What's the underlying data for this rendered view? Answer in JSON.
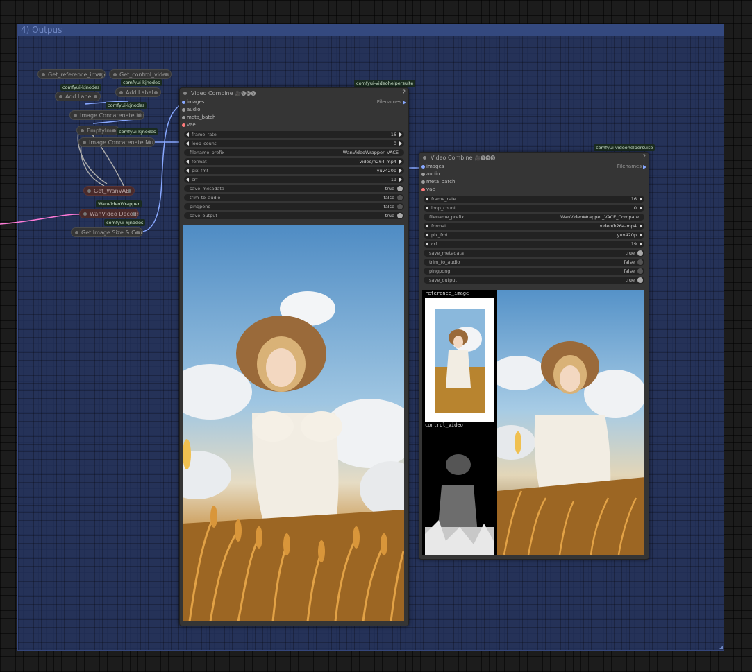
{
  "group": {
    "title": "4) Outpus"
  },
  "mini_nodes": {
    "get_reference_image": "Get_reference_image",
    "get_control_video": "Get_control_video",
    "add_label_1": "Add Label",
    "add_label_2": "Add Label",
    "image_concat_1": "Image Concatenate Mu",
    "empty_image": "EmptyIma",
    "image_concat_2": "Image Concatenate Mu",
    "get_wanvae": "Get_WanVAE",
    "wanvideo_decode": "WanVideo Decode",
    "get_image_size": "Get Image Size & Cou"
  },
  "tags": {
    "kjnodes_1": "comfyui-kjnodes",
    "kjnodes_2": "comfyui-kjnodes",
    "kjnodes_3": "comfyui-kjnodes",
    "kjnodes_4": "comfyui-kjnodes",
    "kjnodes_5": "comfyui-kjnodes",
    "wanvideowrapper": "WanVideoWrapper",
    "vhs_1": "comfyui-videohelpersuite",
    "vhs_2": "comfyui-videohelpersuite"
  },
  "video_combine_1": {
    "title": "Video Combine",
    "title_icons": "🎥🅥🅗🅢",
    "help": "?",
    "inputs": [
      "images",
      "audio",
      "meta_batch",
      "vae"
    ],
    "output_label": "Filenames",
    "widgets": {
      "frame_rate": {
        "label": "frame_rate",
        "value": "16"
      },
      "loop_count": {
        "label": "loop_count",
        "value": "0"
      },
      "filename_prefix": {
        "label": "filename_prefix",
        "value": "WanVideoWrapper_VACE"
      },
      "format": {
        "label": "format",
        "value": "video/h264-mp4"
      },
      "pix_fmt": {
        "label": "pix_fmt",
        "value": "yuv420p"
      },
      "crf": {
        "label": "crf",
        "value": "19"
      },
      "save_metadata": {
        "label": "save_metadata",
        "value": "true"
      },
      "trim_to_audio": {
        "label": "trim_to_audio",
        "value": "false"
      },
      "pingpong": {
        "label": "pingpong",
        "value": "false"
      },
      "save_output": {
        "label": "save_output",
        "value": "true"
      }
    }
  },
  "video_combine_2": {
    "title": "Video Combine",
    "title_icons": "🎥🅥🅗🅢",
    "help": "?",
    "inputs": [
      "images",
      "audio",
      "meta_batch",
      "vae"
    ],
    "output_label": "Filenames",
    "widgets": {
      "frame_rate": {
        "label": "frame_rate",
        "value": "16"
      },
      "loop_count": {
        "label": "loop_count",
        "value": "0"
      },
      "filename_prefix": {
        "label": "filename_prefix",
        "value": "WanVideoWrapper_VACE_Compare"
      },
      "format": {
        "label": "format",
        "value": "video/h264-mp4"
      },
      "pix_fmt": {
        "label": "pix_fmt",
        "value": "yuv420p"
      },
      "crf": {
        "label": "crf",
        "value": "19"
      },
      "save_metadata": {
        "label": "save_metadata",
        "value": "true"
      },
      "trim_to_audio": {
        "label": "trim_to_audio",
        "value": "false"
      },
      "pingpong": {
        "label": "pingpong",
        "value": "false"
      },
      "save_output": {
        "label": "save_output",
        "value": "true"
      }
    },
    "preview_labels": {
      "reference": "reference_image",
      "control": "control_video"
    }
  },
  "colors": {
    "group_fill": "#293b70",
    "node_bg": "#353535",
    "wire_image": "#88a8ff",
    "wire_vae": "#ff7bd8"
  }
}
